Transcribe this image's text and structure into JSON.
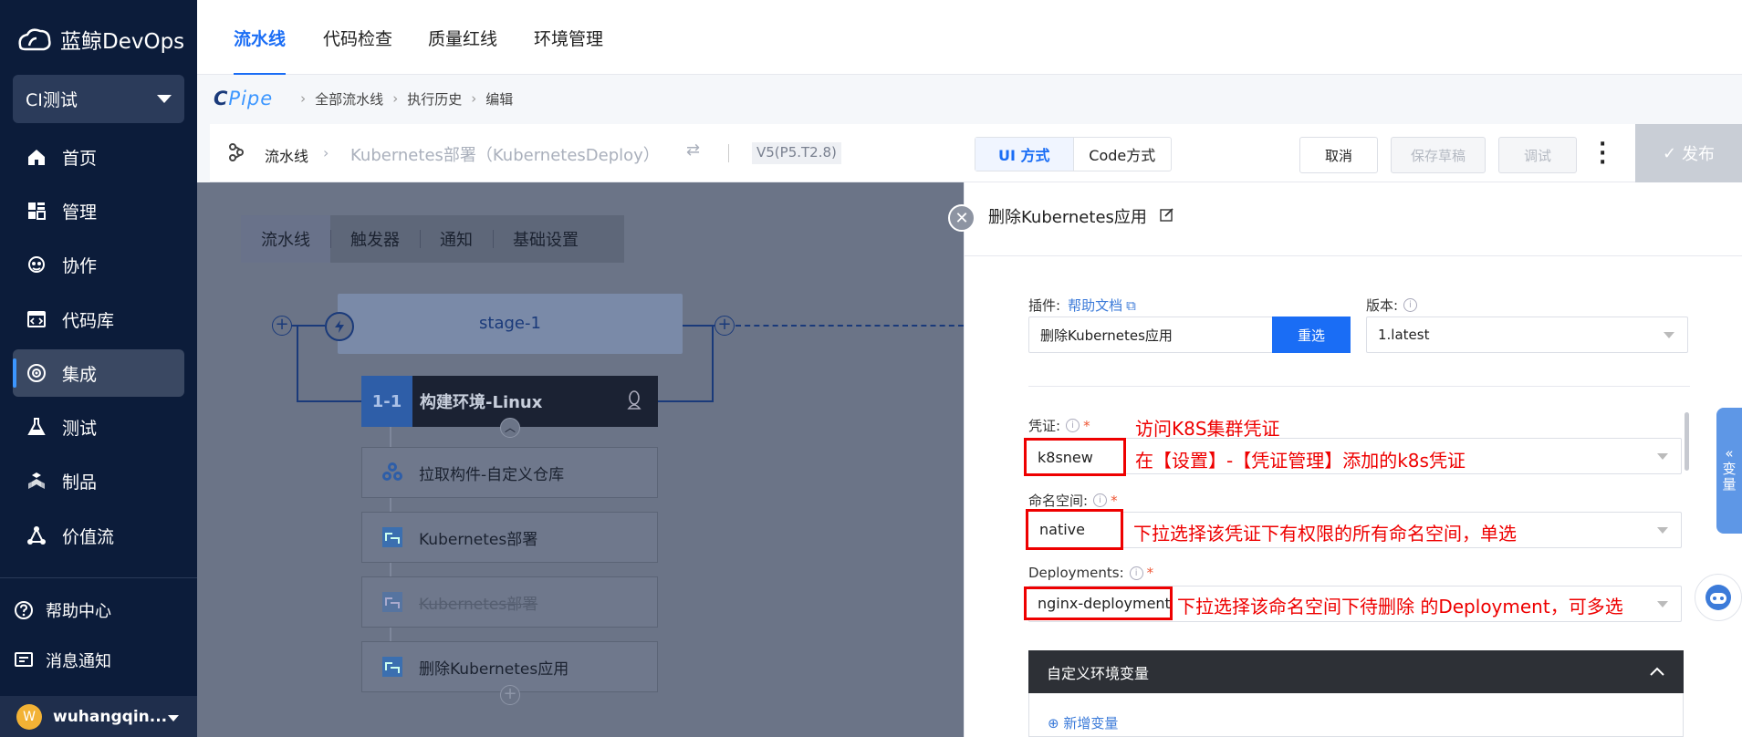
{
  "app": {
    "logo_text": "蓝鲸DevOps",
    "project": "CI测试"
  },
  "sidebar": {
    "items": [
      {
        "label": "首页",
        "icon": "home-icon"
      },
      {
        "label": "管理",
        "icon": "grid-icon"
      },
      {
        "label": "协作",
        "icon": "cooperation-icon"
      },
      {
        "label": "代码库",
        "icon": "code-repo-icon"
      },
      {
        "label": "集成",
        "icon": "integration-icon",
        "active": true
      },
      {
        "label": "测试",
        "icon": "test-icon"
      },
      {
        "label": "制品",
        "icon": "artifact-icon"
      },
      {
        "label": "价值流",
        "icon": "value-stream-icon"
      }
    ],
    "help": "帮助中心",
    "notifications": "消息通知",
    "user": {
      "initial": "W",
      "name": "wuhangqin..."
    }
  },
  "topnav": {
    "tabs": [
      "流水线",
      "代码检查",
      "质量红线",
      "环境管理"
    ]
  },
  "breadcrumb": {
    "brand_c": "C",
    "brand_pipe": "Pipe",
    "items": [
      "全部流水线",
      "执行历史",
      "编辑"
    ]
  },
  "toolbar": {
    "crumb_root": "流水线",
    "pipeline_name": "Kubernetes部署（KubernetesDeploy）",
    "version": "V5(P5.T2.8)",
    "mode_ui": "UI 方式",
    "mode_code": "Code方式",
    "cancel": "取消",
    "save_draft": "保存草稿",
    "debug": "调试",
    "publish": "发布"
  },
  "editor": {
    "tabs": [
      "流水线",
      "触发器",
      "通知",
      "基础设置"
    ],
    "stage": "stage-1",
    "job_num": "1-1",
    "job_title": "构建环境-Linux",
    "tasks": [
      {
        "label": "拉取构件-自定义仓库",
        "disabled": false
      },
      {
        "label": "Kubernetes部署",
        "disabled": false
      },
      {
        "label": "Kubernetes部署",
        "disabled": true
      },
      {
        "label": "删除Kubernetes应用",
        "disabled": false
      }
    ]
  },
  "panel": {
    "title": "删除Kubernetes应用",
    "plugin_label": "插件:",
    "help_doc": "帮助文档",
    "plugin_value": "删除Kubernetes应用",
    "reselect": "重选",
    "version_label": "版本:",
    "version_value": "1.latest",
    "credential_label": "凭证:",
    "credential_value": "k8snew",
    "namespace_label": "命名空间:",
    "namespace_value": "native",
    "deployments_label": "Deployments:",
    "deployments_value": "nginx-deployment",
    "env_section": "自定义环境变量",
    "env_add": "新增变量",
    "side_tab": [
      "«",
      "变",
      "量"
    ]
  },
  "annotations": {
    "a1": "访问K8S集群凭证",
    "a2": "在【设置】-【凭证管理】添加的k8s凭证",
    "a3": "下拉选择该凭证下有权限的所有命名空间，单选",
    "a4": "下拉选择该命名空间下待删除 的Deployment，可多选"
  },
  "colors": {
    "sidebar": "#0c1c3a",
    "accent": "#1a6df5",
    "annotation": "#ee0000"
  }
}
